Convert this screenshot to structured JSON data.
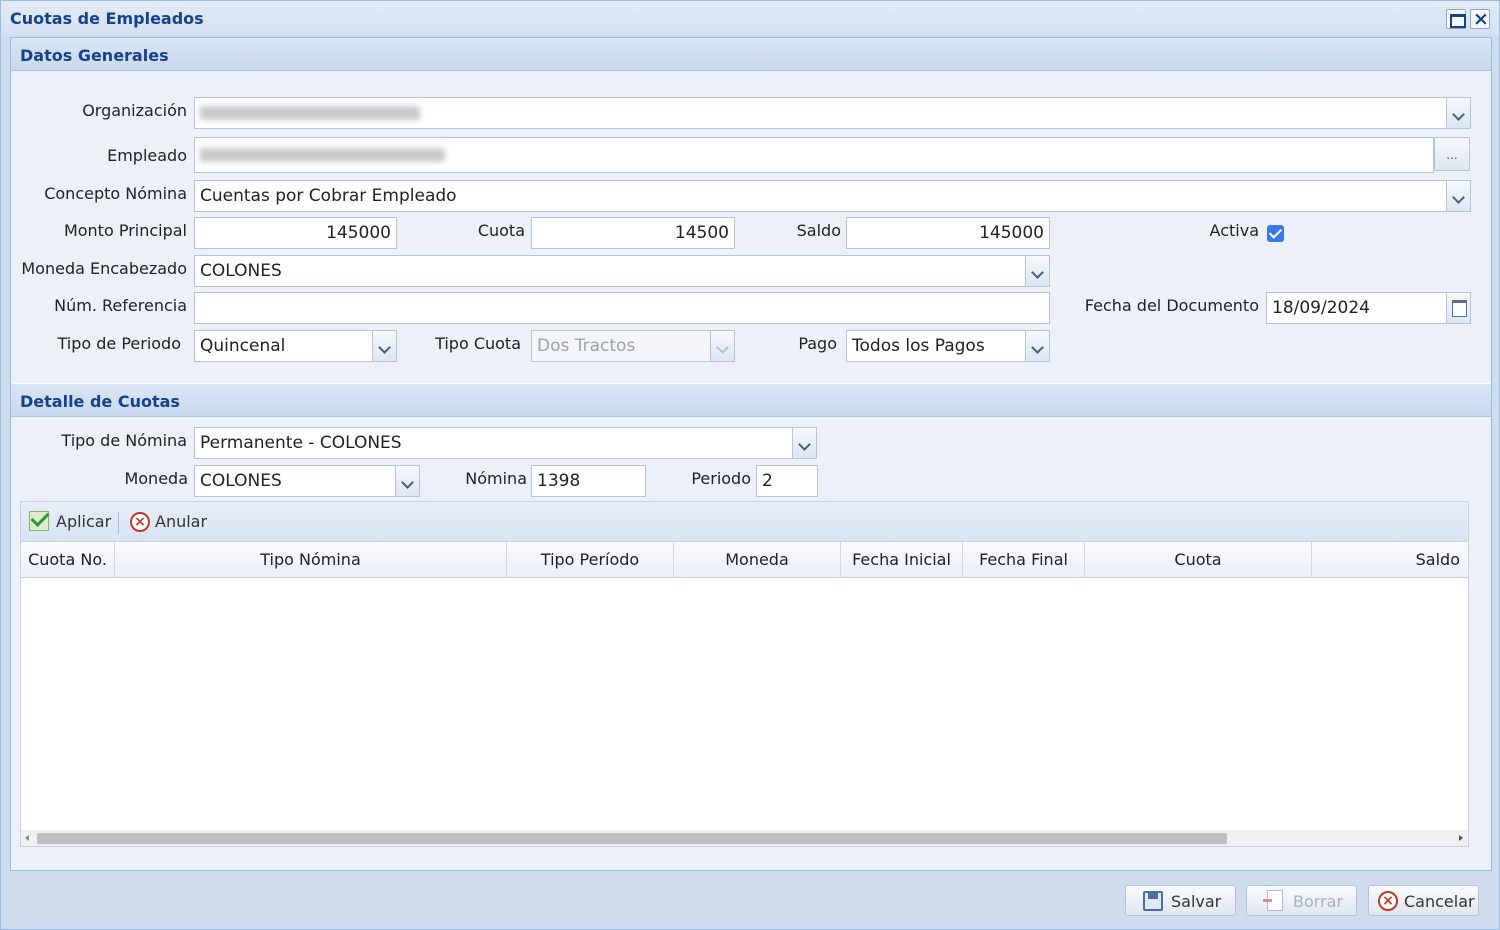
{
  "window": {
    "title": "Cuotas de Empleados"
  },
  "general": {
    "section_title": "Datos Generales",
    "organizacion_label": "Organización",
    "empleado_label": "Empleado",
    "empleado_browse": "...",
    "concepto_label": "Concepto Nómina",
    "concepto_value": "Cuentas por Cobrar Empleado",
    "monto_label": "Monto Principal",
    "monto_value": "145000",
    "cuota_label": "Cuota",
    "cuota_value": "14500",
    "saldo_label": "Saldo",
    "saldo_value": "145000",
    "activa_label": "Activa",
    "moneda_label": "Moneda Encabezado",
    "moneda_value": "COLONES",
    "referencia_label": "Núm. Referencia",
    "referencia_value": "",
    "fecha_label": "Fecha del Documento",
    "fecha_value": "18/09/2024",
    "tipo_periodo_label": "Tipo de Periodo",
    "tipo_periodo_value": "Quincenal",
    "tipo_cuota_label": "Tipo Cuota",
    "tipo_cuota_value": "Dos Tractos",
    "pago_label": "Pago",
    "pago_value": "Todos los Pagos"
  },
  "detalle": {
    "section_title": "Detalle de Cuotas",
    "tipo_nomina_label": "Tipo de Nómina",
    "tipo_nomina_value": "Permanente - COLONES",
    "moneda_label": "Moneda",
    "moneda_value": "COLONES",
    "nomina_label": "Nómina",
    "nomina_value": "1398",
    "periodo_label": "Periodo",
    "periodo_value": "2",
    "toolbar": {
      "aplicar": "Aplicar",
      "anular": "Anular"
    },
    "columns": [
      "Cuota No.",
      "Tipo Nómina",
      "Tipo Período",
      "Moneda",
      "Fecha Inicial",
      "Fecha Final",
      "Cuota",
      "Saldo"
    ]
  },
  "footer": {
    "salvar": "Salvar",
    "borrar": "Borrar",
    "cancelar": "Cancelar"
  }
}
